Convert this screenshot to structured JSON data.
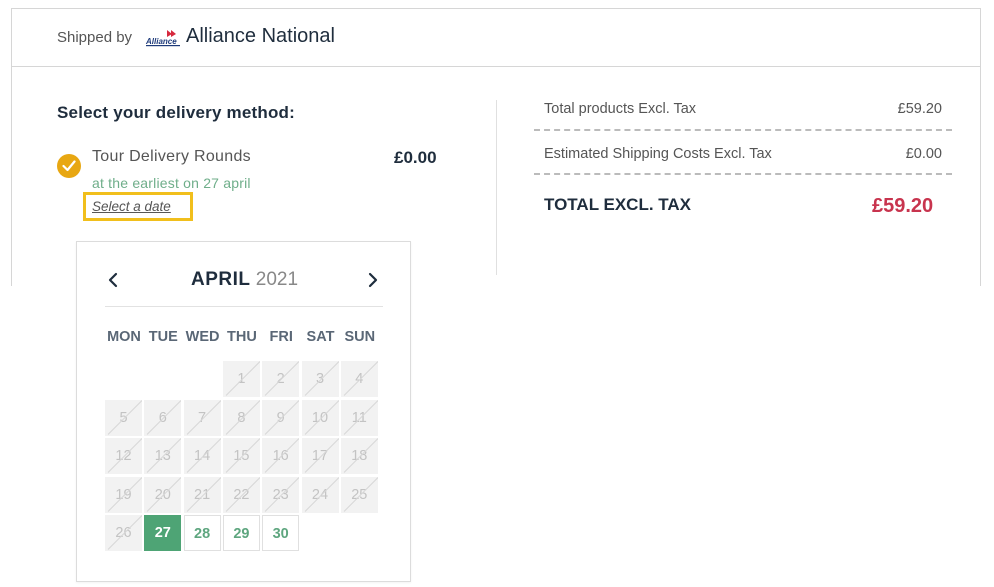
{
  "shipping": {
    "label": "Shipped by",
    "logo_text": "Alliance",
    "name": "Alliance National"
  },
  "delivery": {
    "title": "Select your delivery method:",
    "method_name": "Tour Delivery Rounds",
    "method_price": "£0.00",
    "earliest_text": "at the earliest on 27 april",
    "select_date_label": "Select a date"
  },
  "summary": {
    "products_label": "Total products Excl. Tax",
    "products_value": "£59.20",
    "shipping_label": "Estimated Shipping Costs Excl. Tax",
    "shipping_value": "£0.00",
    "total_label": "TOTAL EXCL. TAX",
    "total_value": "£59.20"
  },
  "calendar": {
    "month": "APRIL",
    "year": "2021",
    "prev_icon": "chevron-left-icon",
    "next_icon": "chevron-right-icon",
    "weekdays": [
      "MON",
      "TUE",
      "WED",
      "THU",
      "FRI",
      "SAT",
      "SUN"
    ],
    "first_weekday_index": 3,
    "days_in_month": 30,
    "available_days": [
      27,
      28,
      29,
      30
    ],
    "selected_day": 27
  },
  "colors": {
    "check_badge": "#e8a712",
    "highlight_border": "#f1bf1c",
    "available_green": "#5ea67f",
    "selected_green": "#4ea475",
    "total_red": "#c8344e"
  }
}
